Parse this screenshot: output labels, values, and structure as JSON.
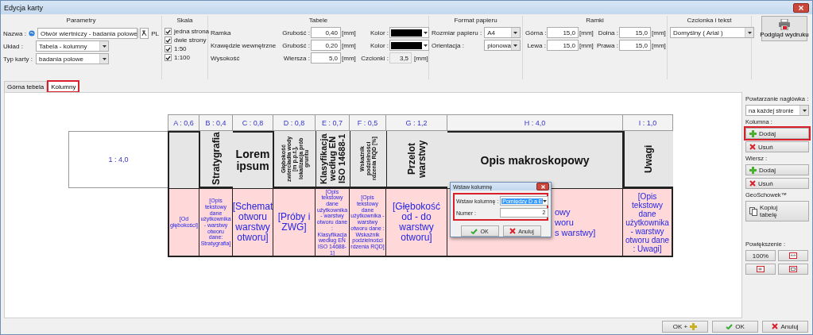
{
  "window": {
    "title": "Edycja karty"
  },
  "toolbar": {
    "parameters": {
      "title": "Parametry",
      "name_label": "Nazwa :",
      "name_value": "Otwór wiertniczy - badania polowe",
      "language": "PL",
      "layout_label": "Układ :",
      "layout_value": "Tabela - kolumny",
      "type_label": "Typ karty :",
      "type_value": "badania polowe"
    },
    "scale": {
      "title": "Skala",
      "options": [
        {
          "label": "jedna strona",
          "checked": true
        },
        {
          "label": "dwie strony",
          "checked": true
        },
        {
          "label": "1:50",
          "checked": true
        },
        {
          "label": "1:100",
          "checked": true
        }
      ]
    },
    "tables": {
      "title": "Tabele",
      "rows": [
        {
          "kind": "line",
          "label": "Ramka",
          "field_label": "Grubość :",
          "value": "0,40",
          "unit": "[mm]",
          "color_label": "Kolor :",
          "color": "#000000"
        },
        {
          "kind": "line",
          "label": "Krawędzie wewnętrzne",
          "field_label": "Grubość :",
          "value": "0,20",
          "unit": "[mm]",
          "color_label": "Kolor :",
          "color": "#000000"
        },
        {
          "kind": "height",
          "label": "Wysokość",
          "field_label": "Wiersza :",
          "value": "5,0",
          "unit": "[mm]",
          "font_label": "Czcionki :",
          "font_value": "3,5",
          "font_unit": "[mm]",
          "font_disabled": true
        }
      ]
    },
    "paper": {
      "title": "Format papieru",
      "size_label": "Rozmiar papieru :",
      "size": "A4",
      "orientation_label": "Orientacja :",
      "orientation": "pionowa"
    },
    "margins": {
      "title": "Ramki",
      "fields": [
        {
          "label": "Górna :",
          "value": "15,0",
          "unit": "[mm]"
        },
        {
          "label": "Dolna :",
          "value": "15,0",
          "unit": "[mm]"
        },
        {
          "label": "Lewa :",
          "value": "15,0",
          "unit": "[mm]"
        },
        {
          "label": "Prawa :",
          "value": "15,0",
          "unit": "[mm]"
        }
      ]
    },
    "font": {
      "title": "Czcionka i tekst",
      "value": "Domyślny ( Arial )"
    },
    "preview_button": {
      "label": "Podgląd wydruku"
    }
  },
  "tabs": [
    {
      "label": "Górna tebela",
      "selected": false,
      "highlighted": false
    },
    {
      "label": "Kolumny",
      "selected": true,
      "highlighted": true
    }
  ],
  "table": {
    "row_block": "1 : 4,0",
    "columns": [
      {
        "width_label": "A : 0,6",
        "header": {
          "kind": "empty"
        },
        "body": {
          "kind": "tiny",
          "text": "[Od głębokości]"
        }
      },
      {
        "width_label": "B : 0,4",
        "header": {
          "kind": "vertical",
          "text": "Stratygrafia"
        },
        "body": {
          "kind": "micro",
          "text": "[Opis tekstowy dane użytkownika - warstwy otworu dane: Stratygrafia]"
        }
      },
      {
        "width_label": "C : 0,8",
        "header": {
          "kind": "horizontal",
          "text": "Lorem ipsum"
        },
        "body": {
          "kind": "large",
          "text": "[Schemat otworu warstwy otworu]"
        }
      },
      {
        "width_label": "D : 0,8",
        "header": {
          "kind": "vertical-tiny",
          "text": "Głębokość zwierciadła wody [m p.p.t.], lokalizacja prób gruntu"
        },
        "body": {
          "kind": "large",
          "text": "[Próby i ZWG]"
        }
      },
      {
        "width_label": "E : 0,7",
        "header": {
          "kind": "vertical",
          "text": "Klasyfikacja według EN ISO 14688-1"
        },
        "body": {
          "kind": "small",
          "text": "[Opis tekstowy dane użytkownika - warstwy otworu dane : Klasyfikacja według EN ISO 14688-1]"
        }
      },
      {
        "width_label": "F : 0,5",
        "header": {
          "kind": "vertical-micro",
          "text": "Wskaźnik podzielności rdzenia RQD [%]"
        },
        "body": {
          "kind": "micro",
          "text": "[Opis tekstowy dane użytkownika - warstwy otworu dane : Wskaźnik podzielności rdzenia RQD]"
        }
      },
      {
        "width_label": "G : 1,2",
        "header": {
          "kind": "vertical",
          "text": "Przelot warstwy"
        },
        "body": {
          "kind": "large",
          "text": "[Głębokość od - do warstwy otworu]"
        }
      },
      {
        "width_label": "H : 4,0",
        "header": {
          "kind": "horizontal",
          "text": "Opis makroskopowy"
        },
        "body": {
          "kind": "partial",
          "lines": [
            "owy",
            "woru",
            "s warstwy]"
          ]
        }
      },
      {
        "width_label": "I : 1,0",
        "header": {
          "kind": "vertical",
          "text": "Uwagi"
        },
        "body": {
          "kind": "medium",
          "text": "[Opis tekstowy dane użytkownika - warstwy otworu dane : Uwagi]"
        }
      }
    ]
  },
  "dialog": {
    "title": "Wstaw kolumnę",
    "insert_label": "Wstaw kolumnę :",
    "insert_value": "Pomiędzy D a E",
    "number_label": "Numer :",
    "number_value": "2",
    "highlighted": true,
    "buttons": [
      {
        "kind": "ok",
        "label": "OK"
      },
      {
        "kind": "cancel",
        "label": "Anuluj"
      }
    ]
  },
  "side_panel": {
    "header_repeat": {
      "label": "Powtarzanie nagłówka :",
      "value": "na każdej stronie"
    },
    "groups": [
      {
        "label": "Kolumna :",
        "buttons": [
          {
            "kind": "add",
            "label": "Dodaj",
            "highlighted": true
          },
          {
            "kind": "remove",
            "label": "Usuń",
            "highlighted": false
          }
        ]
      },
      {
        "label": "Wiersz :",
        "buttons": [
          {
            "kind": "add",
            "label": "Dodaj",
            "highlighted": false
          },
          {
            "kind": "remove",
            "label": "Usuń",
            "highlighted": false
          }
        ]
      }
    ],
    "clipboard": {
      "label": "GeoSchowek™",
      "button": "Kopiuj tabelę"
    },
    "zoom": {
      "label": "Powiększenie :",
      "buttons": [
        {
          "kind": "text",
          "label": "100%"
        },
        {
          "kind": "fit"
        },
        {
          "kind": "page"
        },
        {
          "kind": "frame"
        }
      ]
    }
  },
  "footer_buttons": [
    {
      "kind": "ok-plus",
      "label": "OK +"
    },
    {
      "kind": "ok",
      "label": "OK"
    },
    {
      "kind": "cancel",
      "label": "Anuluj"
    }
  ]
}
